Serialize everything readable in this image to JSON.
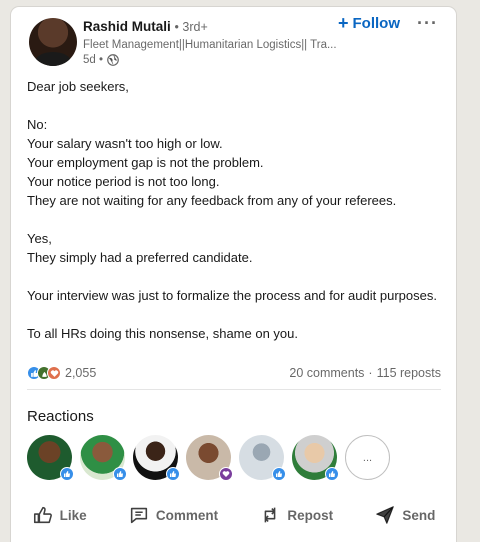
{
  "post": {
    "author": {
      "name": "Rashid Mutali",
      "degree": "• 3rd+",
      "headline": "Fleet Management||Humanitarian Logistics|| Tra...",
      "time": "5d •"
    },
    "follow_label": "Follow",
    "follow_plus": "+",
    "more_label": "···",
    "body": [
      "Dear job seekers,",
      "",
      "No:",
      "Your salary wasn't too high or low.",
      "Your employment gap is not the problem.",
      "Your notice period is not too long.",
      "They are not waiting for any feedback from any of your referees.",
      "",
      "Yes,",
      "They simply had a preferred candidate.",
      "",
      "Your interview was just to formalize the process and for audit purposes.",
      "",
      "To all HRs doing this nonsense, shame on you."
    ],
    "social": {
      "reaction_count": "2,055",
      "comments": "20 comments",
      "separator": "·",
      "reposts": "115 reposts",
      "reaction_types": [
        "like",
        "celebrate",
        "love"
      ]
    },
    "reactions": {
      "title": "Reactions",
      "more_label": "..."
    },
    "actions": {
      "like": "Like",
      "comment": "Comment",
      "repost": "Repost",
      "send": "Send"
    }
  },
  "colors": {
    "accent": "#0a66c2",
    "like": "#378fe9",
    "celebrate": "#44712e",
    "love": "#df704d"
  }
}
